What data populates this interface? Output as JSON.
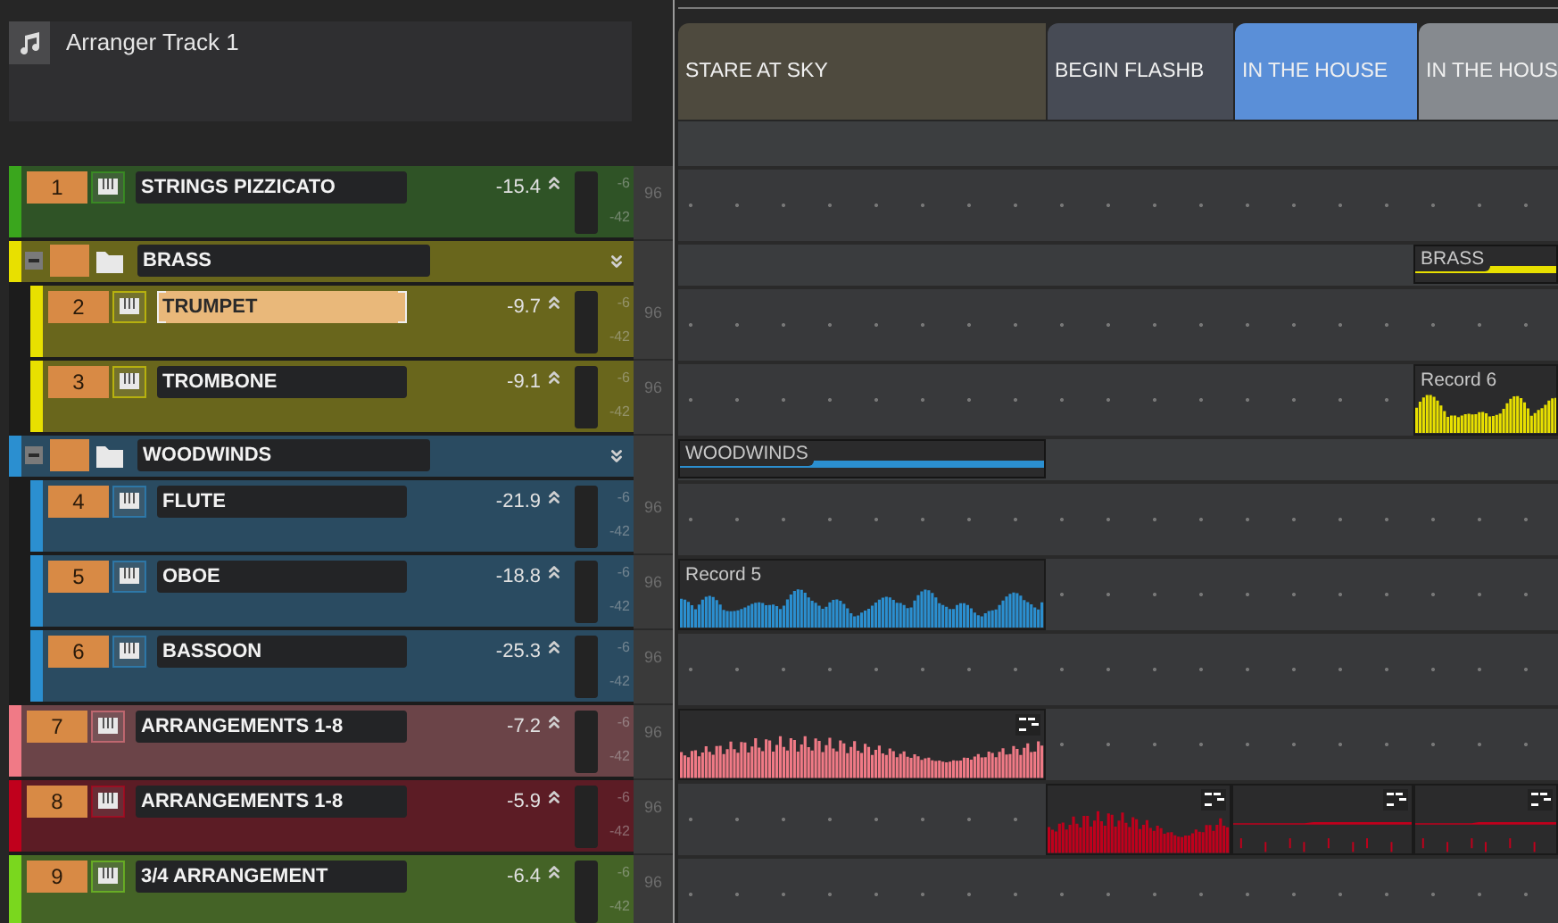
{
  "arranger_track": {
    "title": "Arranger Track 1"
  },
  "sections": [
    {
      "label": "STARE AT SKY",
      "color": "#4e4a3e"
    },
    {
      "label": "BEGIN FLASHB",
      "color": "#474b55"
    },
    {
      "label": "IN THE HOUSE",
      "color": "#5a8fd8"
    },
    {
      "label": "IN THE HOUS",
      "color": "#868a8f"
    }
  ],
  "tracks": [
    {
      "kind": "track",
      "number": "1",
      "name": "STRINGS PIZZICATO",
      "volume": "-15.4",
      "color": "#3aa61d",
      "selected": false,
      "meter_marks": [
        "-6",
        "-42"
      ],
      "lane_value": "96"
    },
    {
      "kind": "folder",
      "name": "BRASS",
      "color": "#e8e000",
      "selected": false,
      "expanded": true,
      "lane": [
        {
          "kind": "empty"
        },
        {
          "kind": "empty"
        },
        {
          "kind": "empty"
        },
        {
          "kind": "folder",
          "label": "BRASS"
        }
      ],
      "children": [
        {
          "kind": "track",
          "number": "2",
          "name": "TRUMPET",
          "volume": "-9.7",
          "color": "#e8e000",
          "selected": true,
          "meter_marks": [
            "-6",
            "-42"
          ],
          "lane_value": "96"
        },
        {
          "kind": "track",
          "number": "3",
          "name": "TROMBONE",
          "volume": "-9.1",
          "color": "#e8e000",
          "selected": false,
          "meter_marks": [
            "-6",
            "-42"
          ],
          "lane_value": "96",
          "lane": [
            {
              "kind": "empty"
            },
            {
              "kind": "empty"
            },
            {
              "kind": "empty"
            },
            {
              "kind": "audio",
              "label": "Record 6"
            }
          ]
        }
      ]
    },
    {
      "kind": "folder",
      "name": "WOODWINDS",
      "color": "#2b8fd0",
      "selected": false,
      "expanded": true,
      "lane": [
        {
          "kind": "folder",
          "label": "WOODWINDS"
        },
        {
          "kind": "empty"
        },
        {
          "kind": "empty"
        },
        {
          "kind": "empty"
        }
      ],
      "children": [
        {
          "kind": "track",
          "number": "4",
          "name": "FLUTE",
          "volume": "-21.9",
          "color": "#2b8fd0",
          "selected": false,
          "meter_marks": [
            "-6",
            "-42"
          ],
          "lane_value": "96"
        },
        {
          "kind": "track",
          "number": "5",
          "name": "OBOE",
          "volume": "-18.8",
          "color": "#2b8fd0",
          "selected": false,
          "meter_marks": [
            "-6",
            "-42"
          ],
          "lane_value": "96",
          "lane": [
            {
              "kind": "audio",
              "label": "Record 5"
            },
            {
              "kind": "empty"
            },
            {
              "kind": "empty"
            },
            {
              "kind": "empty"
            }
          ]
        },
        {
          "kind": "track",
          "number": "6",
          "name": "BASSOON",
          "volume": "-25.3",
          "color": "#2b8fd0",
          "selected": false,
          "meter_marks": [
            "-6",
            "-42"
          ],
          "lane_value": "96"
        }
      ]
    },
    {
      "kind": "track",
      "number": "7",
      "name": "ARRANGEMENTS 1-8",
      "volume": "-7.2",
      "color": "#f07a86",
      "selected": false,
      "meter_marks": [
        "-6",
        "-42"
      ],
      "lane_value": "96",
      "lane": [
        {
          "kind": "envelope"
        },
        {
          "kind": "empty"
        },
        {
          "kind": "empty"
        },
        {
          "kind": "empty"
        }
      ]
    },
    {
      "kind": "track",
      "number": "8",
      "name": "ARRANGEMENTS 1-8",
      "volume": "-5.9",
      "color": "#c0001c",
      "selected": false,
      "meter_marks": [
        "-6",
        "-42"
      ],
      "lane_value": "96",
      "lane": [
        {
          "kind": "empty"
        },
        {
          "kind": "envelope"
        },
        {
          "kind": "line"
        },
        {
          "kind": "line"
        }
      ]
    },
    {
      "kind": "track",
      "number": "9",
      "name": "3/4 ARRANGEMENT",
      "volume": "-6.4",
      "color": "#7ad71e",
      "selected": false,
      "meter_marks": [
        "-6",
        "-42"
      ],
      "lane_value": "96"
    }
  ]
}
